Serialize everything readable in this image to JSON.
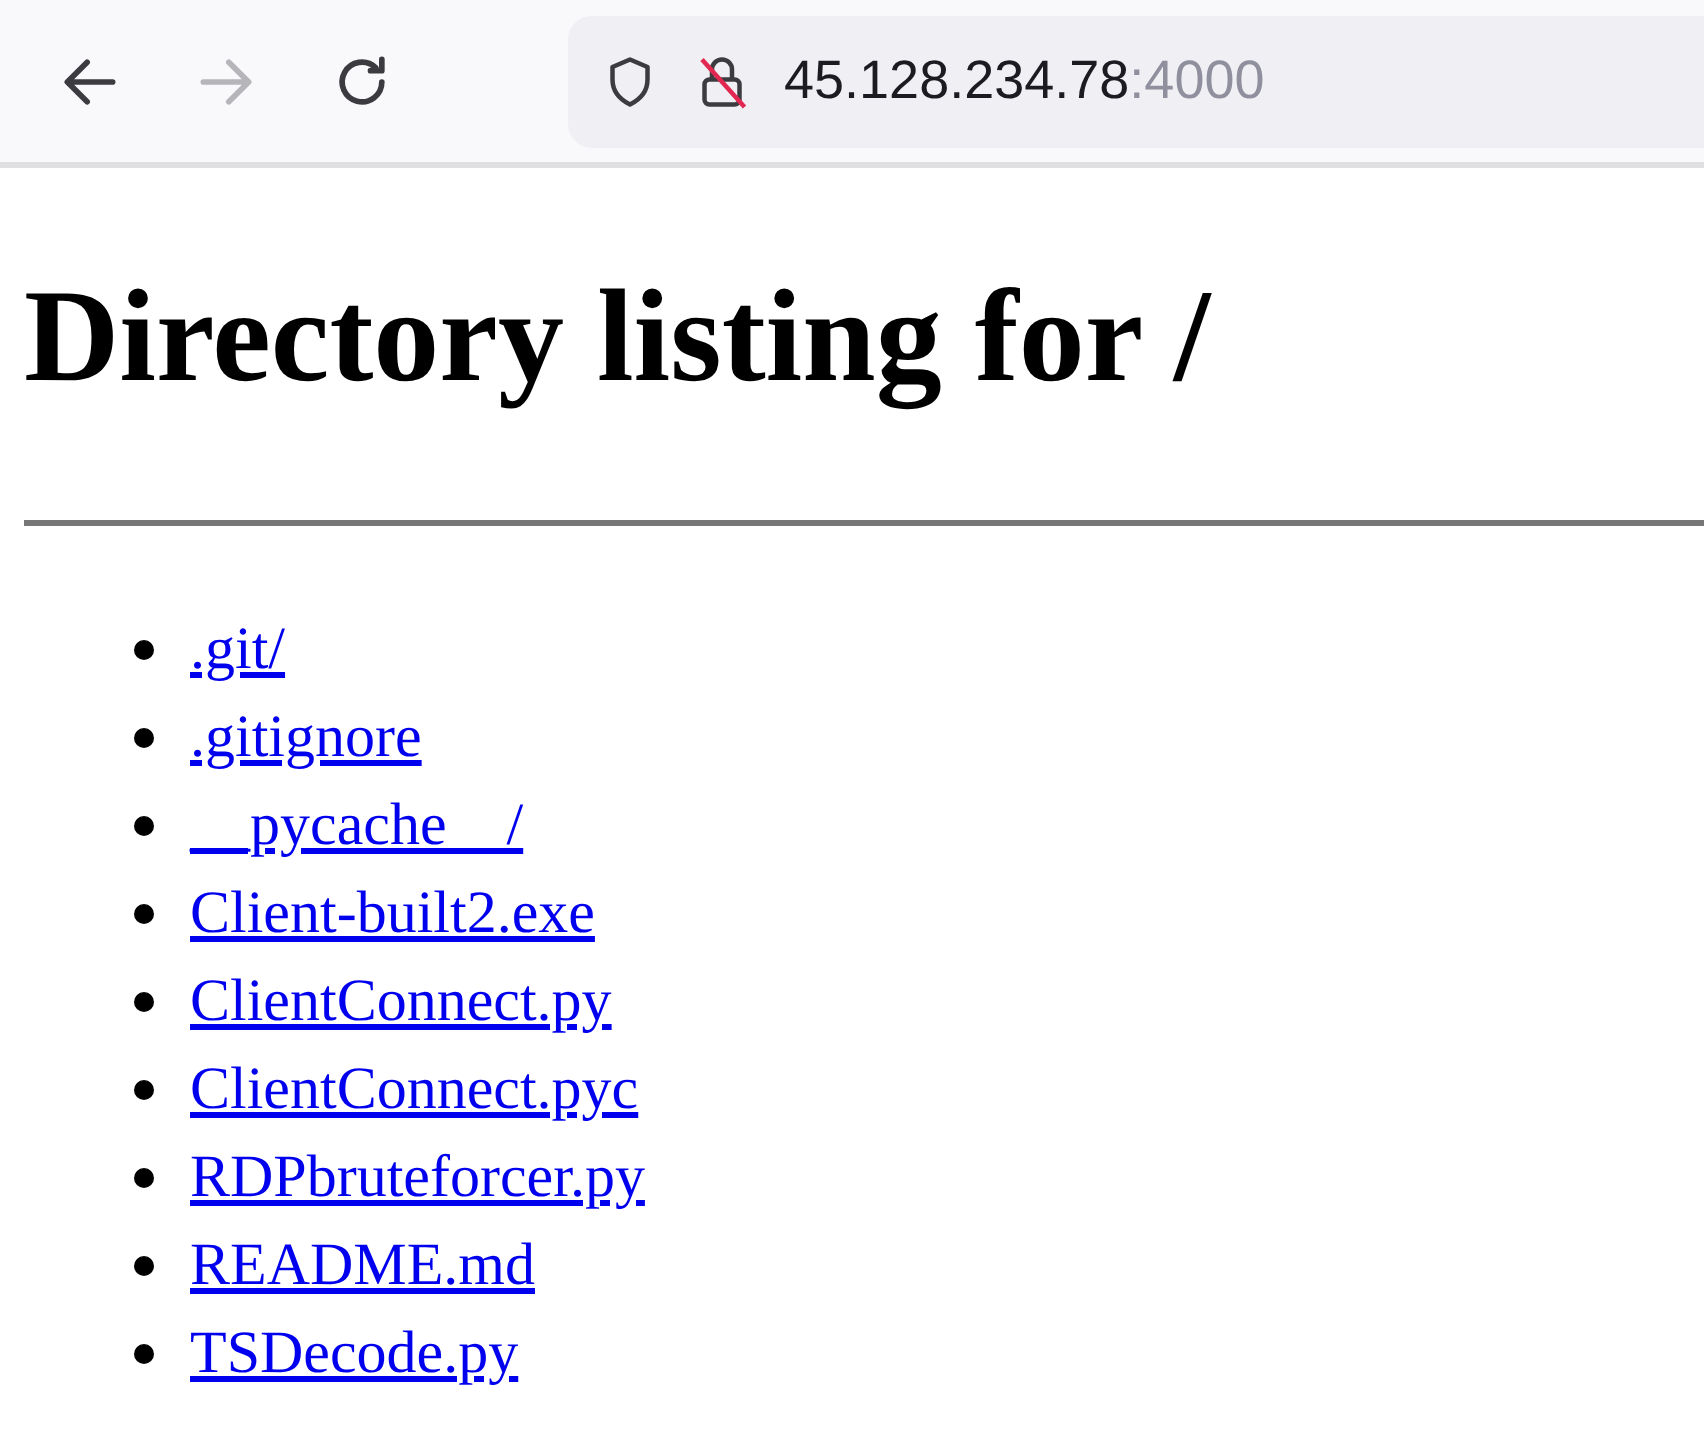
{
  "toolbar": {
    "nav_buttons": [
      {
        "kind": "back",
        "disabled": false
      },
      {
        "kind": "forward",
        "disabled": true
      },
      {
        "kind": "reload",
        "disabled": false
      }
    ],
    "address": {
      "host": "45.128.234.78",
      "port": ":4000"
    }
  },
  "page": {
    "heading": "Directory listing for /",
    "entries": [
      {
        "name": ".git/"
      },
      {
        "name": ".gitignore"
      },
      {
        "name": "__pycache__/"
      },
      {
        "name": "Client-built2.exe"
      },
      {
        "name": "ClientConnect.py"
      },
      {
        "name": "ClientConnect.pyc"
      },
      {
        "name": "RDPbruteforcer.py"
      },
      {
        "name": "README.md"
      },
      {
        "name": "TSDecode.py"
      }
    ]
  }
}
